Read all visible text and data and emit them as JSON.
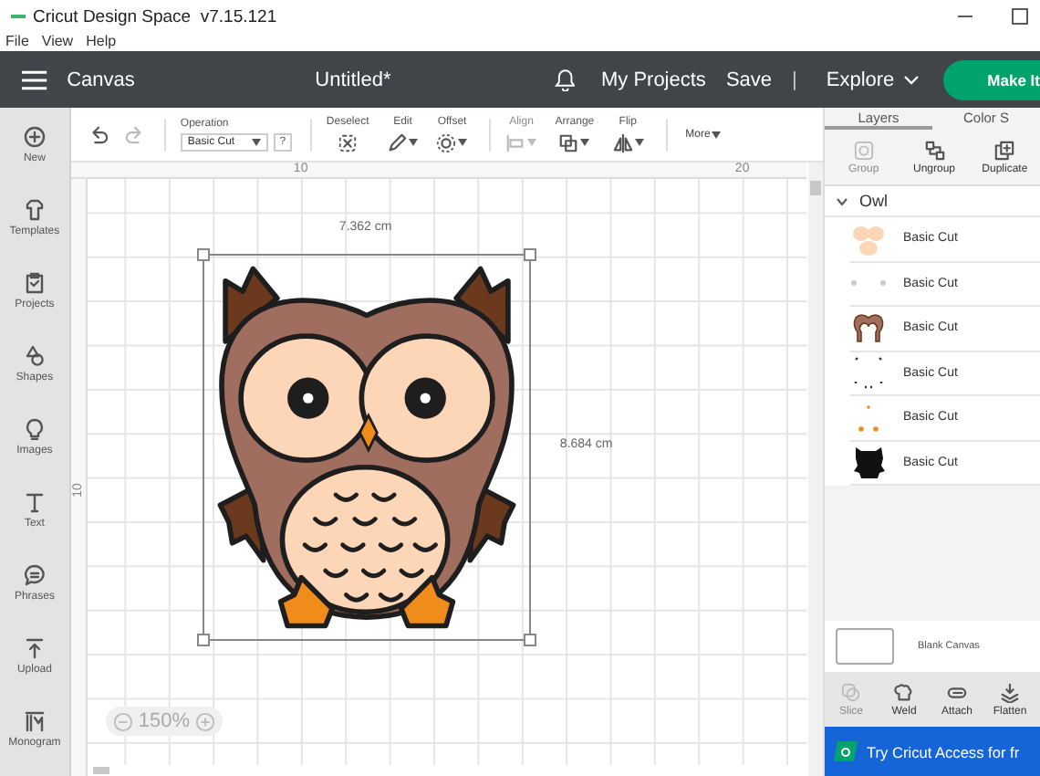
{
  "window": {
    "title": "Cricut Design Space  v7.15.121"
  },
  "menu": [
    "File",
    "View",
    "Help"
  ],
  "header": {
    "section": "Canvas",
    "project_title": "Untitled*",
    "links": [
      "My Projects",
      "Save"
    ],
    "separator": "|",
    "explore": "Explore",
    "make_it": "Make It"
  },
  "sidebar": {
    "items": [
      {
        "label": "New",
        "kind": "new"
      },
      {
        "label": "Templates",
        "kind": "templates"
      },
      {
        "label": "Projects",
        "kind": "projects"
      },
      {
        "label": "Shapes",
        "kind": "shapes"
      },
      {
        "label": "Images",
        "kind": "images"
      },
      {
        "label": "Text",
        "kind": "text"
      },
      {
        "label": "Phrases",
        "kind": "phrases"
      },
      {
        "label": "Upload",
        "kind": "upload"
      },
      {
        "label": "Monogram",
        "kind": "monogram"
      }
    ]
  },
  "toolbar": {
    "history": [
      {
        "kind": "undo",
        "disabled": false
      },
      {
        "kind": "redo",
        "disabled": true
      }
    ],
    "operation": {
      "label": "Operation",
      "value": "Basic Cut",
      "help": "?"
    },
    "tools": [
      {
        "label": "Deselect",
        "kind": "deselect",
        "disabled": false,
        "dropdown": false
      },
      {
        "label": "Edit",
        "kind": "edit",
        "disabled": false,
        "dropdown": true
      },
      {
        "label": "Offset",
        "kind": "offset",
        "disabled": false,
        "dropdown": true
      },
      {
        "label": "Align",
        "kind": "align",
        "disabled": true,
        "dropdown": true
      },
      {
        "label": "Arrange",
        "kind": "arrange",
        "disabled": false,
        "dropdown": true
      },
      {
        "label": "Flip",
        "kind": "flip",
        "disabled": false,
        "dropdown": true
      }
    ],
    "more": "More"
  },
  "canvas": {
    "top_ruler": [
      "10",
      "20"
    ],
    "left_ruler": [
      "10"
    ],
    "width_label": "7.362 cm",
    "height_label": "8.684 cm",
    "zoom": "150%"
  },
  "layers_panel": {
    "tabs": [
      {
        "label": "Layers",
        "selected": true
      },
      {
        "label": "Color S",
        "selected": false
      }
    ],
    "actions": [
      {
        "label": "Group",
        "kind": "group",
        "disabled": true
      },
      {
        "label": "Ungroup",
        "kind": "ungroup",
        "disabled": false
      },
      {
        "label": "Duplicate",
        "kind": "duplicate",
        "disabled": false
      }
    ],
    "group": {
      "name": "Owl",
      "expanded": true,
      "layers": [
        {
          "label": "Basic Cut",
          "kind": "eyes"
        },
        {
          "label": "Basic Cut",
          "kind": "highlights"
        },
        {
          "label": "Basic Cut",
          "kind": "head"
        },
        {
          "label": "Basic Cut",
          "kind": "marks"
        },
        {
          "label": "Basic Cut",
          "kind": "beak-feet"
        },
        {
          "label": "Basic Cut",
          "kind": "silhouette"
        }
      ]
    },
    "blank_canvas": "Blank Canvas",
    "bottom_actions": [
      {
        "label": "Slice",
        "kind": "slice",
        "disabled": true
      },
      {
        "label": "Weld",
        "kind": "weld",
        "disabled": false
      },
      {
        "label": "Attach",
        "kind": "attach",
        "disabled": false
      },
      {
        "label": "Flatten",
        "kind": "flatten",
        "disabled": false
      }
    ],
    "banner": "Try Cricut Access for fr"
  }
}
